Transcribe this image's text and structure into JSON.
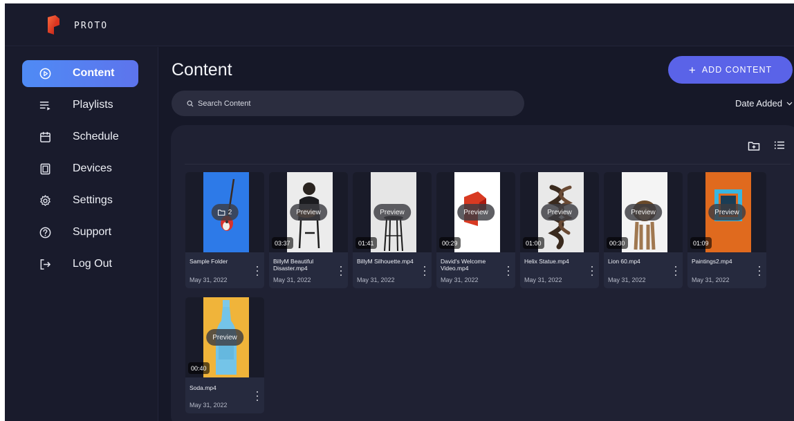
{
  "brand": {
    "name": "PROTO"
  },
  "sidebar": {
    "items": [
      {
        "label": "Content",
        "icon": "play-circle-icon",
        "active": true
      },
      {
        "label": "Playlists",
        "icon": "playlist-icon",
        "active": false
      },
      {
        "label": "Schedule",
        "icon": "calendar-icon",
        "active": false
      },
      {
        "label": "Devices",
        "icon": "device-icon",
        "active": false
      },
      {
        "label": "Settings",
        "icon": "gear-icon",
        "active": false
      },
      {
        "label": "Support",
        "icon": "help-icon",
        "active": false
      },
      {
        "label": "Log Out",
        "icon": "logout-icon",
        "active": false
      }
    ]
  },
  "main": {
    "title": "Content",
    "add_button": "ADD CONTENT",
    "search_placeholder": "Search Content",
    "sort_label": "Date Added"
  },
  "cards": [
    {
      "name": "Sample Folder",
      "date": "May 31, 2022",
      "type": "folder",
      "count": "2",
      "duration": ""
    },
    {
      "name": "BillyM Beautiful Disaster.mp4",
      "date": "May 31, 2022",
      "type": "video",
      "preview": "Preview",
      "duration": "03:37"
    },
    {
      "name": "BillyM Silhouette.mp4",
      "date": "May 31, 2022",
      "type": "video",
      "preview": "Preview",
      "duration": "01:41"
    },
    {
      "name": "David's Welcome Video.mp4",
      "date": "May 31, 2022",
      "type": "video",
      "preview": "Preview",
      "duration": "00:29"
    },
    {
      "name": "Helix Statue.mp4",
      "date": "May 31, 2022",
      "type": "video",
      "preview": "Preview",
      "duration": "01:00"
    },
    {
      "name": "Lion 60.mp4",
      "date": "May 31, 2022",
      "type": "video",
      "preview": "Preview",
      "duration": "00:30"
    },
    {
      "name": "Paintings2.mp4",
      "date": "May 31, 2022",
      "type": "video",
      "preview": "Preview",
      "duration": "01:09"
    },
    {
      "name": "Soda.mp4",
      "date": "May 31, 2022",
      "type": "video",
      "preview": "Preview",
      "duration": "00:40"
    }
  ],
  "colors": {
    "background": "#161828",
    "sidebar": "#191b2c",
    "accent": "#5a63e8",
    "active_nav": "#4f8bf5",
    "card": "#262a3e"
  }
}
